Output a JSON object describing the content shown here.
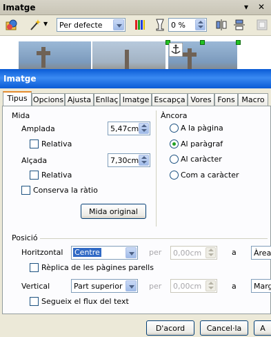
{
  "toolbar_window": {
    "title": "Imatge",
    "menu_arrow": "▾",
    "close": "✕",
    "icons": [
      "image-filter-icon",
      "magic-wand-icon",
      "graphics-mode",
      "color-bars-icon",
      "transparency-glass-icon",
      "flip-vertical-icon",
      "flip-horizontal-icon",
      "frame-properties-icon"
    ],
    "graphics_mode": "Per defecte",
    "transparency": "0 %"
  },
  "dialog": {
    "title": "Imatge",
    "tabs": [
      "Tipus",
      "Opcions",
      "Ajusta",
      "Enllaç",
      "Imatge",
      "Escapça",
      "Vores",
      "Fons",
      "Macro"
    ],
    "active_tab": "Tipus",
    "size": {
      "heading": "Mida",
      "width_label": "Amplada",
      "width_value": "5,47cm",
      "relative1": "Relativa",
      "height_label": "Alçada",
      "height_value": "7,30cm",
      "relative2": "Relativa",
      "keep_ratio": "Conserva la ràtio",
      "original_size": "Mida original"
    },
    "anchor": {
      "heading": "Àncora",
      "options": [
        "A la pàgina",
        "Al paràgraf",
        "Al caràcter",
        "Com a caràcter"
      ],
      "selected": "Al paràgraf"
    },
    "position": {
      "heading": "Posició",
      "horizontal_label": "Horitzontal",
      "horizontal_value": "Centre",
      "per1": "per",
      "h_offset": "0,00cm",
      "a1": "a",
      "h_to": "Àrea",
      "mirror": "Rèplica de les pàgines parells",
      "vertical_label": "Vertical",
      "vertical_value": "Part superior",
      "per2": "per",
      "v_offset": "0,00cm",
      "a2": "a",
      "v_to": "Marge",
      "follow_flow": "Segueix el flux del text"
    },
    "buttons": {
      "ok": "D'acord",
      "cancel": "Cancel·la",
      "help": "A"
    }
  }
}
